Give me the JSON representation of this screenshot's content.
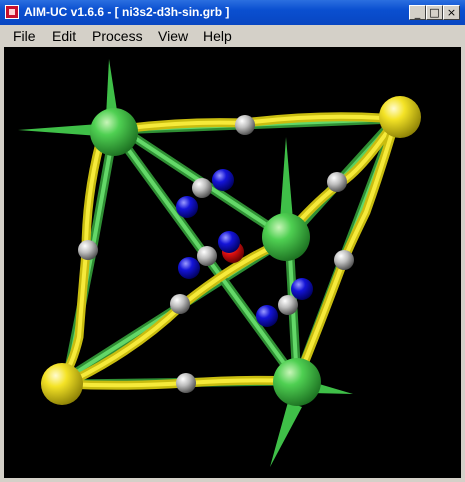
{
  "window": {
    "title": "AIM-UC v1.6.6 - [ ni3s2-d3h-sin.grb ]",
    "controls": {
      "minimize": "_",
      "maximize": "□",
      "close": "×"
    }
  },
  "menu": {
    "file": "File",
    "edit": "Edit",
    "process": "Process",
    "view": "View",
    "help": "Help"
  },
  "scene": {
    "icon": "molecule-3d-view",
    "colors": {
      "background": "#000000",
      "nickel_atom": "#3fbf48",
      "sulfur_atom": "#f2e326",
      "bond_critical_point": "#bdbdbd",
      "ring_critical_point": "#1414d8",
      "cage_critical_point": "#e01010"
    }
  }
}
